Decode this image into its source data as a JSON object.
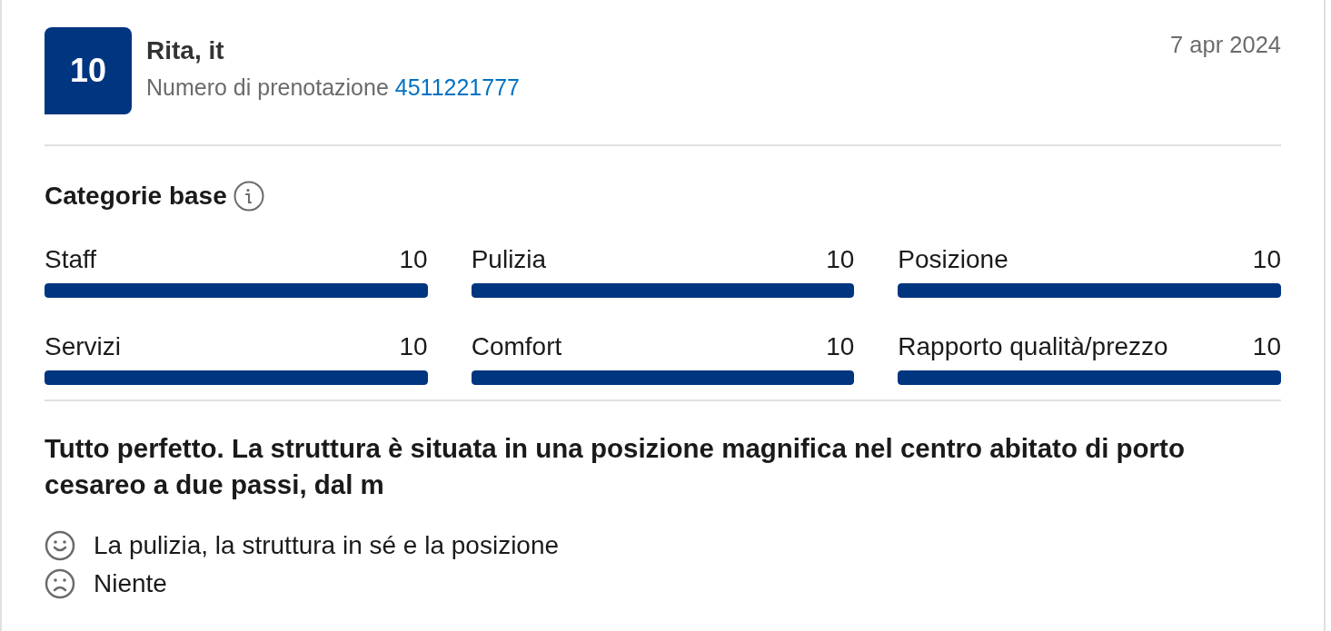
{
  "review": {
    "score": "10",
    "reviewer": "Rita, it",
    "booking_label": "Numero di prenotazione",
    "booking_number": "4511221777",
    "date": "7 apr 2024"
  },
  "categories": {
    "title": "Categorie base",
    "items": [
      {
        "name": "Staff",
        "score": "10",
        "level": 1
      },
      {
        "name": "Pulizia",
        "score": "10",
        "level": 1
      },
      {
        "name": "Posizione",
        "score": "10",
        "level": 1
      },
      {
        "name": "Servizi",
        "score": "10",
        "level": 1
      },
      {
        "name": "Comfort",
        "score": "10",
        "level": 1
      },
      {
        "name": "Rapporto qualità/prezzo",
        "score": "10",
        "level": 1
      }
    ]
  },
  "comment": "Tutto perfetto. La struttura è situata in una posizione magnifica nel centro abitato di porto cesareo a due passi, dal m",
  "notes": [
    {
      "kind": "positive",
      "text": "La pulizia, la struttura in sé e la posizione"
    },
    {
      "kind": "negative",
      "text": "Niente"
    }
  ]
}
